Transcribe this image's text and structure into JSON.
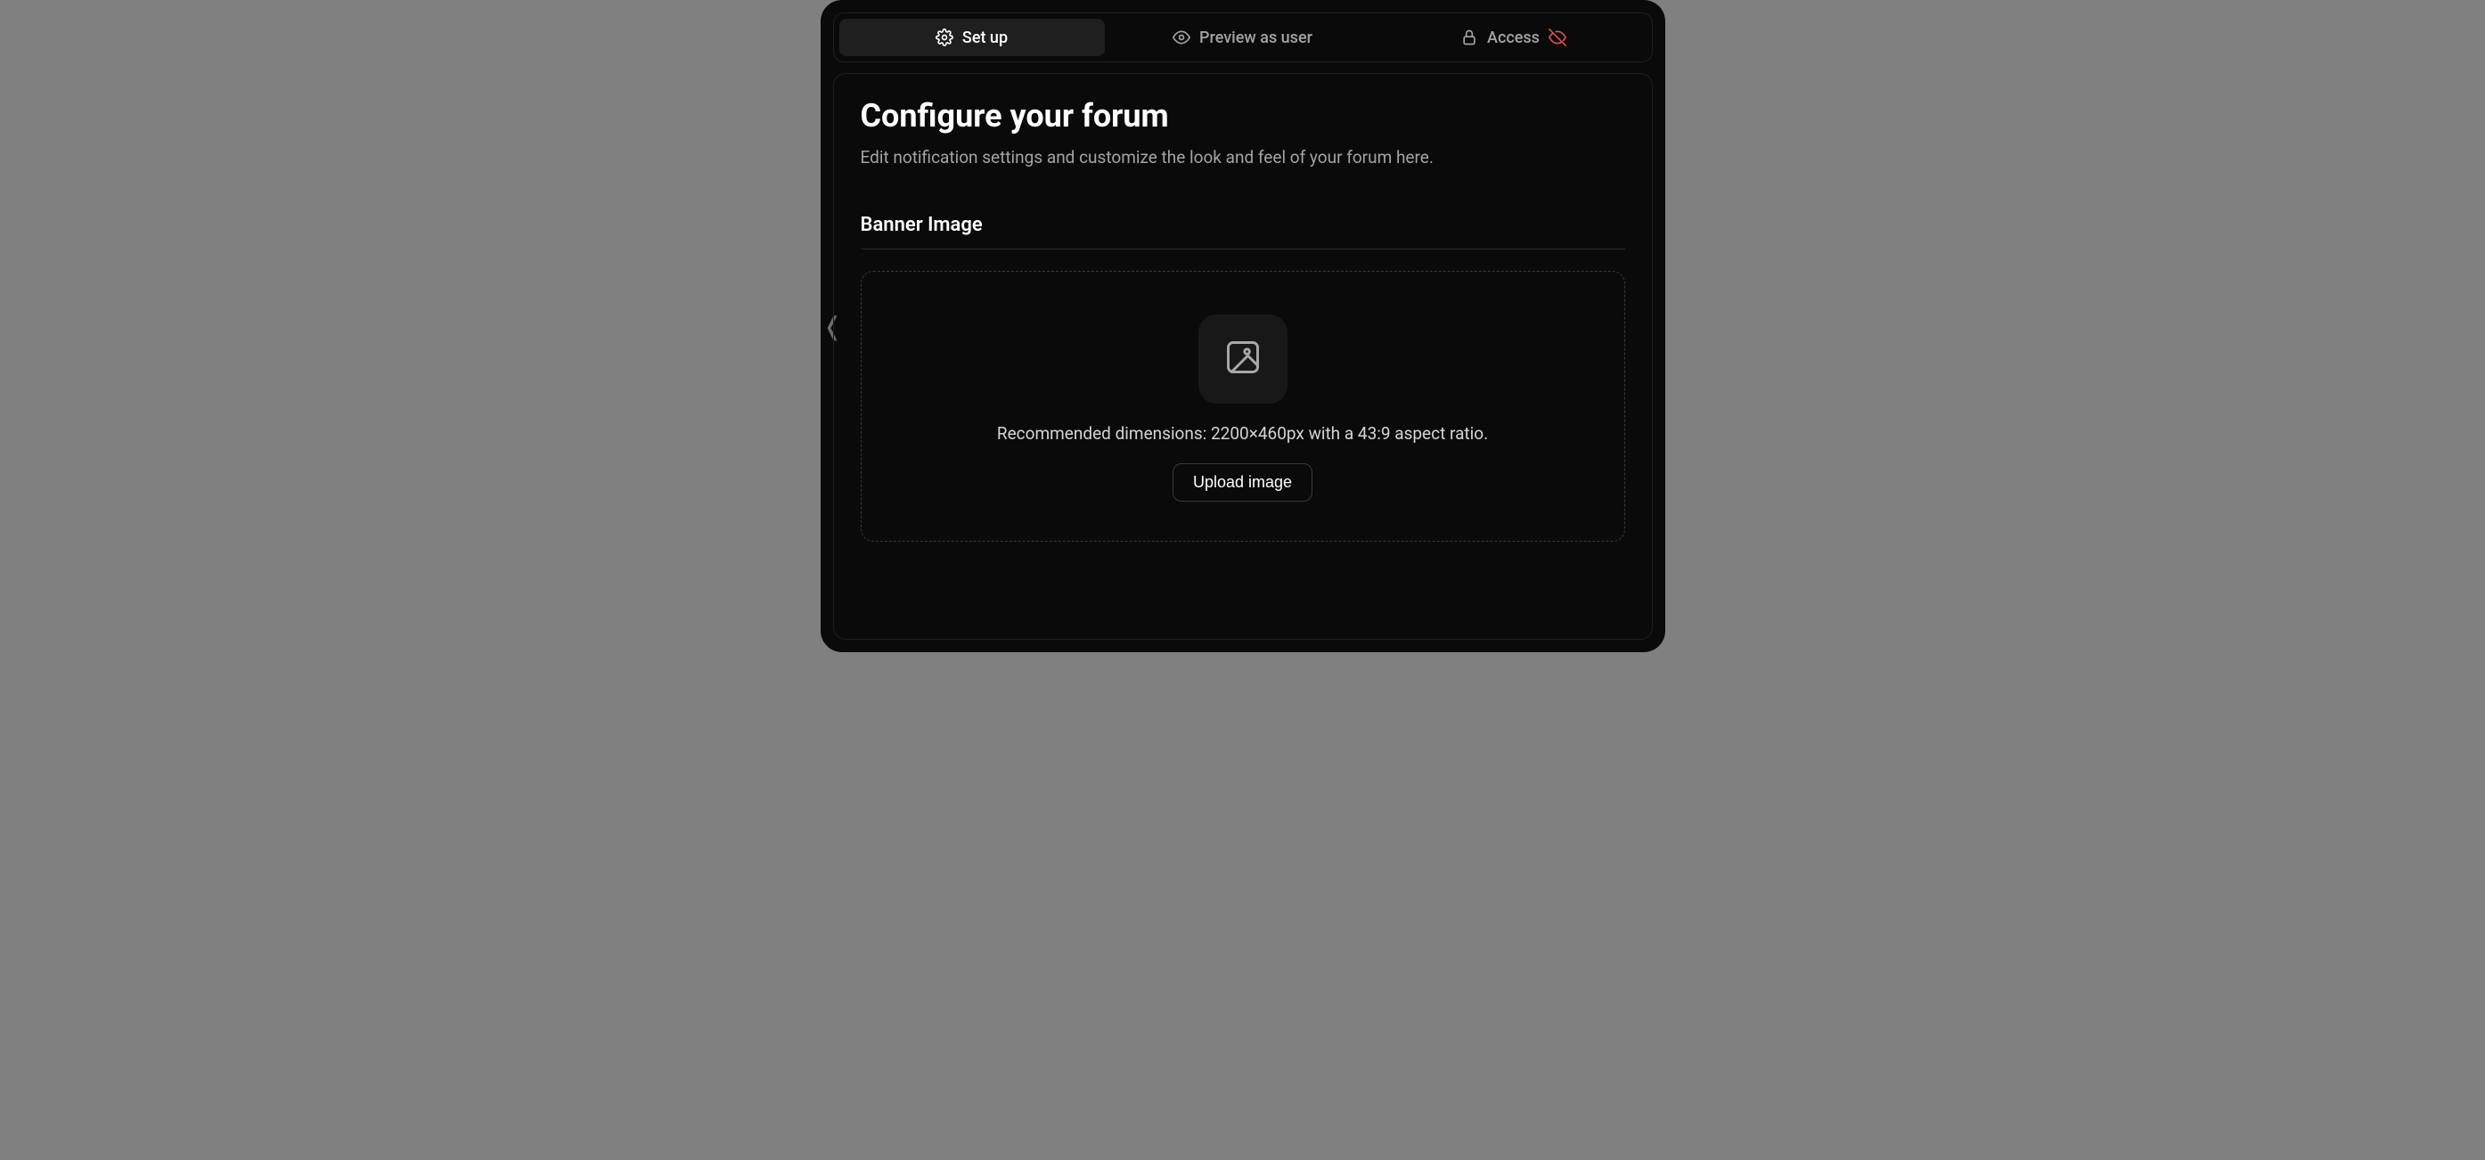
{
  "tabs": {
    "setup": {
      "label": "Set up"
    },
    "preview": {
      "label": "Preview as user"
    },
    "access": {
      "label": "Access"
    }
  },
  "header": {
    "title": "Configure your forum",
    "subtitle": "Edit notification settings and customize the look and feel of your forum here."
  },
  "banner": {
    "section_title": "Banner Image",
    "recommended": "Recommended dimensions: 2200×460px with a 43:9 aspect ratio.",
    "upload_label": "Upload image"
  }
}
